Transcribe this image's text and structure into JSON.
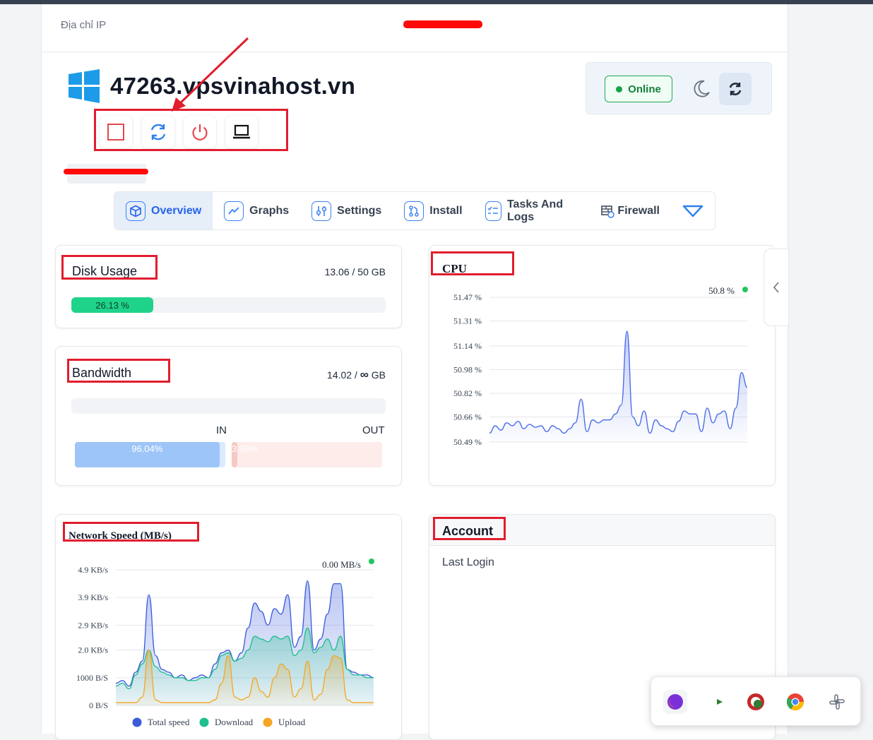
{
  "ip_label": "Địa chỉ IP",
  "hostname": "47263.vpsvinahost.vn",
  "status": {
    "label": "Online",
    "color": "#16a34a"
  },
  "actions": [
    "stop-icon",
    "restart-icon",
    "power-icon",
    "console-icon"
  ],
  "tabs": [
    {
      "label": "Overview",
      "icon": "cube-icon",
      "active": true
    },
    {
      "label": "Graphs",
      "icon": "chart-line-icon"
    },
    {
      "label": "Settings",
      "icon": "sliders-icon"
    },
    {
      "label": "Install",
      "icon": "git-icon"
    },
    {
      "label": "Tasks And Logs",
      "icon": "list-check-icon"
    },
    {
      "label": "Firewall",
      "icon": "firewall-icon"
    },
    {
      "label": "",
      "icon": "chevron-down-icon"
    }
  ],
  "disk": {
    "title": "Disk Usage",
    "value": "13.06 / 50 GB",
    "percent_label": "26.13 %",
    "percent": 26.13
  },
  "bandwidth": {
    "title": "Bandwidth",
    "value_pre": "14.02 / ",
    "value_infinity": "∞",
    "value_unit": " GB",
    "in_label": "IN",
    "out_label": "OUT",
    "in_percent_label": "96.04%",
    "in_percent": 96.04,
    "out_percent_label": "3.96%",
    "out_percent": 3.96
  },
  "cpu": {
    "title": "CPU",
    "current": "50.8 %"
  },
  "network": {
    "title": "Network Speed (MB/s)",
    "current": "0.00 MB/s"
  },
  "account": {
    "title": "Account",
    "last_login_label": "Last Login"
  },
  "tray": [
    "firefox-icon",
    "play-icon",
    "shield-app-icon",
    "chrome-icon",
    "slack-icon"
  ],
  "chart_data": [
    {
      "type": "area",
      "title": "CPU",
      "ylim": [
        50.49,
        51.47
      ],
      "ytick_labels": [
        "51.47 %",
        "51.31 %",
        "51.14 %",
        "50.98 %",
        "50.82 %",
        "50.66 %",
        "50.49 %"
      ],
      "ytick_values": [
        51.47,
        51.31,
        51.14,
        50.98,
        50.82,
        50.66,
        50.49
      ],
      "series": [
        {
          "values": [
            50.55,
            50.6,
            50.57,
            50.62,
            50.6,
            50.63,
            50.58,
            50.61,
            50.59,
            50.6,
            50.56,
            50.6,
            50.58,
            50.55,
            50.58,
            50.62,
            50.78,
            50.56,
            50.64,
            50.62,
            50.64,
            50.64,
            50.68,
            50.74,
            51.24,
            50.66,
            50.6,
            50.7,
            50.55,
            50.64,
            50.6,
            50.58,
            50.56,
            50.63,
            50.7,
            50.68,
            50.68,
            50.56,
            50.72,
            50.62,
            50.68,
            50.7,
            50.58,
            50.72,
            50.96,
            50.86
          ]
        }
      ],
      "color": "#4f6fe8"
    },
    {
      "type": "area",
      "title": "Network Speed (MB/s)",
      "ytick_labels": [
        "4.9 KB/s",
        "3.9 KB/s",
        "2.9 KB/s",
        "2.0 KB/s",
        "1000 B/S",
        "0 B/S"
      ],
      "ytick_values": [
        4.9,
        3.9,
        2.9,
        2.0,
        1.0,
        0
      ],
      "ylim": [
        0,
        4.9
      ],
      "legend": "bottom",
      "series": [
        {
          "name": "Total speed",
          "color": "#3b5bdb",
          "values": [
            0.8,
            0.9,
            0.7,
            1.2,
            1.6,
            4.0,
            1.8,
            1.3,
            1.2,
            1.0,
            1.1,
            0.9,
            1.0,
            1.1,
            1.0,
            1.5,
            1.9,
            2.0,
            1.6,
            1.9,
            2.8,
            3.7,
            3.4,
            2.9,
            3.5,
            3.3,
            4.0,
            2.1,
            2.5,
            4.5,
            2.0,
            2.4,
            3.3,
            4.4,
            4.4,
            1.3,
            1.2,
            1.1,
            1.1,
            1.0
          ]
        },
        {
          "name": "Download",
          "color": "#1fbf8f",
          "values": [
            0.7,
            0.8,
            0.6,
            1.1,
            1.5,
            2.0,
            1.4,
            1.2,
            1.1,
            1.0,
            1.0,
            0.9,
            0.9,
            1.0,
            1.0,
            1.3,
            1.8,
            1.9,
            1.6,
            1.7,
            2.0,
            2.5,
            2.4,
            2.3,
            2.5,
            2.4,
            2.5,
            1.8,
            2.0,
            2.8,
            1.9,
            2.1,
            2.4,
            2.0,
            2.5,
            1.3,
            1.1,
            1.1,
            1.0,
            1.0
          ]
        },
        {
          "name": "Upload",
          "color": "#f5a623",
          "values": [
            0.1,
            0.1,
            0.1,
            0.1,
            0.3,
            2.0,
            0.2,
            0.1,
            0.1,
            0.1,
            0.1,
            0.1,
            0.1,
            0.1,
            0.1,
            0.2,
            0.8,
            1.8,
            0.3,
            0.2,
            0.3,
            1.0,
            0.5,
            0.3,
            1.0,
            1.5,
            1.3,
            0.3,
            0.6,
            1.6,
            0.2,
            0.4,
            1.3,
            1.8,
            1.7,
            0.2,
            0.1,
            0.1,
            0.1,
            0.1
          ]
        }
      ]
    }
  ]
}
